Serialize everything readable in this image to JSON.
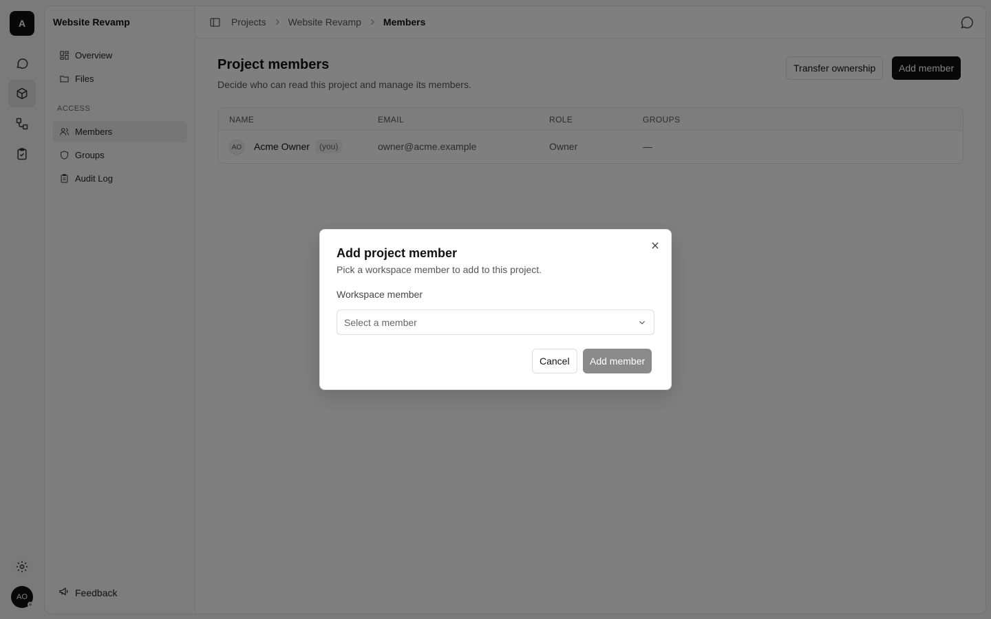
{
  "rail": {
    "logo_letter": "A",
    "icons": [
      "chat-bubble-icon",
      "box-icon",
      "workflow-icon",
      "clipboard-check-icon"
    ],
    "settings_icon": "gear-icon",
    "avatar_initials": "AO"
  },
  "sidebar": {
    "project_title": "Website Revamp",
    "items": [
      {
        "label": "Overview",
        "icon": "grid-icon"
      },
      {
        "label": "Files",
        "icon": "folder-icon"
      }
    ],
    "section_label": "ACCESS",
    "access_items": [
      {
        "label": "Members",
        "icon": "users-icon",
        "active": true
      },
      {
        "label": "Groups",
        "icon": "shield-icon"
      },
      {
        "label": "Audit Log",
        "icon": "clipboard-icon"
      }
    ],
    "feedback_label": "Feedback"
  },
  "topbar": {
    "breadcrumbs": [
      "Projects",
      "Website Revamp",
      "Members"
    ]
  },
  "main": {
    "title": "Project members",
    "subtitle": "Decide who can read this project and manage its members.",
    "transfer_label": "Transfer ownership",
    "add_member_label": "Add member",
    "table": {
      "headers": [
        "NAME",
        "EMAIL",
        "ROLE",
        "GROUPS"
      ],
      "rows": [
        {
          "initials": "AO",
          "name": "Acme Owner",
          "badge": "(you)",
          "email": "owner@acme.example",
          "role": "Owner",
          "groups": "—"
        }
      ]
    }
  },
  "modal": {
    "title": "Add project member",
    "subtitle": "Pick a workspace member to add to this project.",
    "field_label": "Workspace member",
    "select_placeholder": "Select a member",
    "cancel_label": "Cancel",
    "submit_label": "Add member"
  }
}
